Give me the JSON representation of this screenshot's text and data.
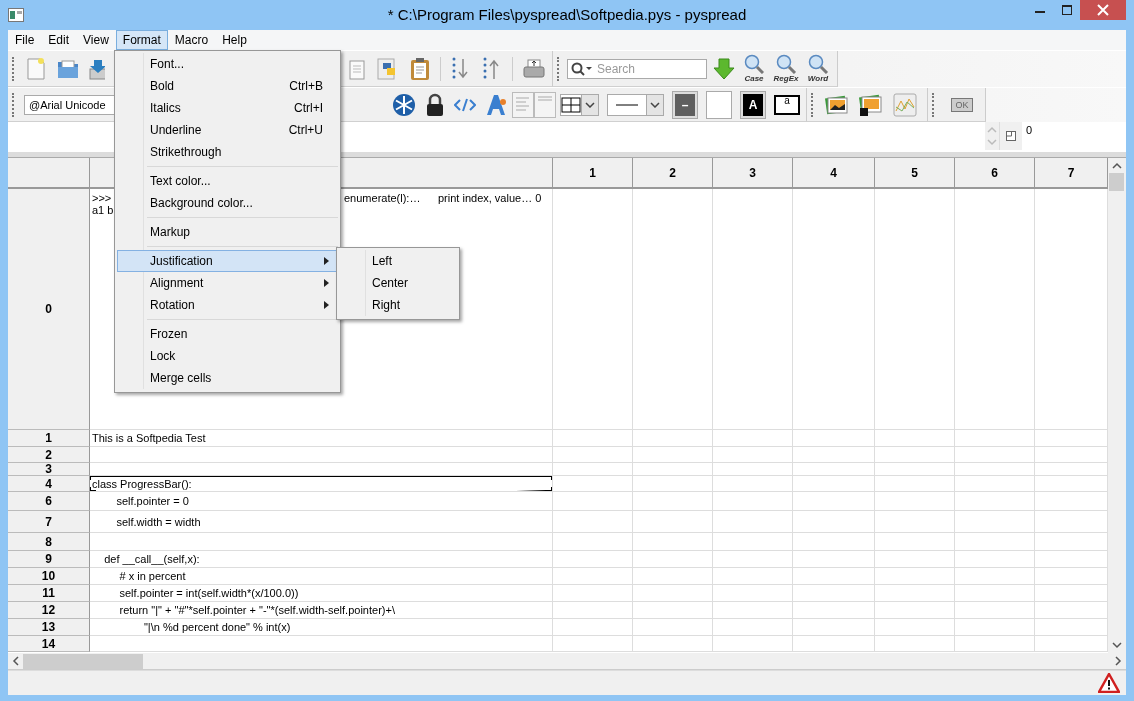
{
  "window": {
    "title": "* C:\\Program Files\\pyspread\\Softpedia.pys - pyspread"
  },
  "menu_bar": [
    {
      "label": "File",
      "selected": false
    },
    {
      "label": "Edit",
      "selected": false
    },
    {
      "label": "View",
      "selected": false
    },
    {
      "label": "Format",
      "selected": true
    },
    {
      "label": "Macro",
      "selected": false
    },
    {
      "label": "Help",
      "selected": false
    }
  ],
  "main_toolbar": {
    "search": {
      "placeholder": "Search"
    },
    "find_options": [
      "Case",
      "RegEx",
      "Word"
    ]
  },
  "format_toolbar": {
    "font": {
      "value": "@Arial Unicode"
    },
    "background_swatch": "–",
    "text_color_swatch": "A",
    "merge_label": "a",
    "ok_label": "OK"
  },
  "entry_line": {
    "table_index": "0"
  },
  "grid": {
    "columns": [
      "1",
      "2",
      "3",
      "4",
      "5",
      "6",
      "7"
    ],
    "rows": [
      {
        "header": "0",
        "kind": "multiline",
        "parts": [
          ">>>",
          "enumerate(l):…",
          "print index, value… 0"
        ],
        "line2": "a1 b",
        "selected": false
      },
      {
        "header": "1",
        "kind": "text",
        "text": "This is a Softpedia Test",
        "selected": false
      },
      {
        "header": "2",
        "kind": "text",
        "text": "",
        "selected": false
      },
      {
        "header": "3",
        "kind": "text",
        "text": "",
        "selected": false
      },
      {
        "header": "4",
        "kind": "text",
        "text": "class ProgressBar():",
        "selected": true
      },
      {
        "header": "6",
        "kind": "text",
        "text": "        self.pointer = 0",
        "selected": false
      },
      {
        "header": "7",
        "kind": "text",
        "text": "        self.width = width",
        "selected": false
      },
      {
        "header": "8",
        "kind": "text",
        "text": "",
        "selected": false
      },
      {
        "header": "9",
        "kind": "text",
        "text": "    def __call__(self,x):",
        "selected": false
      },
      {
        "header": "10",
        "kind": "text",
        "text": "         # x in percent",
        "selected": false
      },
      {
        "header": "11",
        "kind": "text",
        "text": "         self.pointer = int(self.width*(x/100.0))",
        "selected": false
      },
      {
        "header": "12",
        "kind": "text",
        "text": "         return \"|\" + \"#\"*self.pointer + \"-\"*(self.width-self.pointer)+\\",
        "selected": false
      },
      {
        "header": "13",
        "kind": "text",
        "text": "                 \"|\\n %d percent done\" % int(x)",
        "selected": false
      },
      {
        "header": "14",
        "kind": "text",
        "text": "",
        "selected": false
      }
    ]
  },
  "format_menu": {
    "items": [
      {
        "kind": "item",
        "label": "Font...",
        "selected": false
      },
      {
        "kind": "item",
        "label": "Bold",
        "shortcut": "Ctrl+B",
        "selected": false
      },
      {
        "kind": "item",
        "label": "Italics",
        "shortcut": "Ctrl+I",
        "selected": false
      },
      {
        "kind": "item",
        "label": "Underline",
        "shortcut": "Ctrl+U",
        "selected": false
      },
      {
        "kind": "item",
        "label": "Strikethrough",
        "selected": false
      },
      {
        "kind": "separator"
      },
      {
        "kind": "item",
        "label": "Text color...",
        "selected": false
      },
      {
        "kind": "item",
        "label": "Background color...",
        "selected": false
      },
      {
        "kind": "separator"
      },
      {
        "kind": "item",
        "label": "Markup",
        "selected": false
      },
      {
        "kind": "separator"
      },
      {
        "kind": "submenu",
        "label": "Justification",
        "selected": true
      },
      {
        "kind": "submenu",
        "label": "Alignment",
        "selected": false
      },
      {
        "kind": "submenu",
        "label": "Rotation",
        "selected": false
      },
      {
        "kind": "separator"
      },
      {
        "kind": "item",
        "label": "Frozen",
        "selected": false
      },
      {
        "kind": "item",
        "label": "Lock",
        "selected": false
      },
      {
        "kind": "item",
        "label": "Merge cells",
        "selected": false
      }
    ]
  },
  "justification_submenu": {
    "items": [
      "Left",
      "Center",
      "Right"
    ]
  }
}
